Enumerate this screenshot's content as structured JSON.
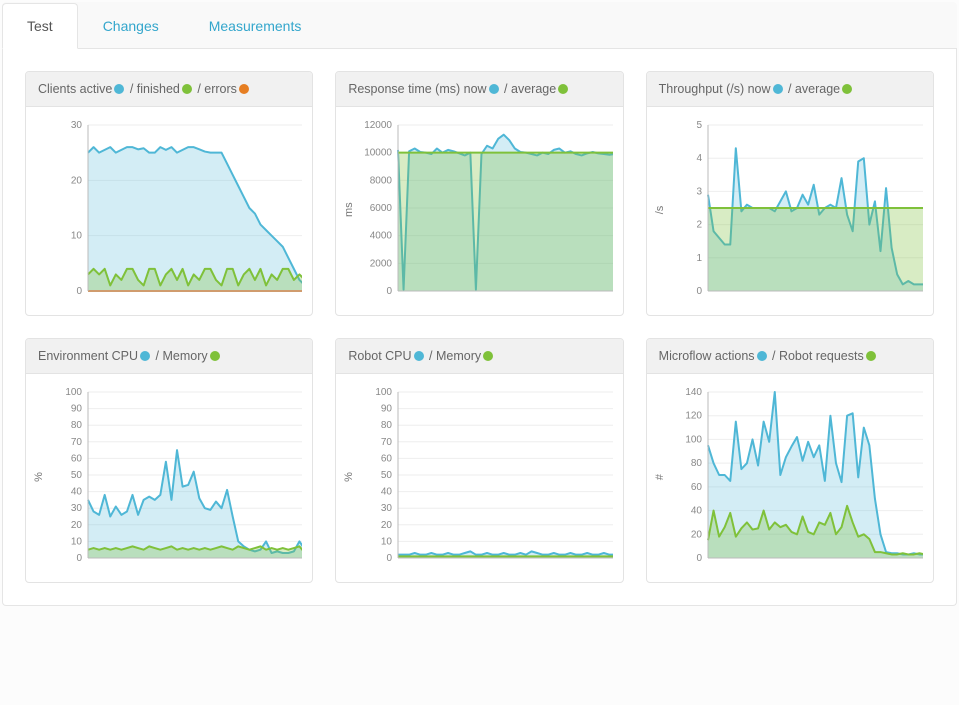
{
  "tabs": {
    "test": "Test",
    "changes": "Changes",
    "measurements": "Measurements"
  },
  "colors": {
    "blue": "#4fb7d6",
    "green": "#7fc13a",
    "orange": "#e67e22"
  },
  "cards": [
    {
      "title_parts": [
        "Clients active",
        " / finished",
        " / errors"
      ],
      "ylabel": ""
    },
    {
      "title_parts": [
        "Response time (ms) now",
        " / average"
      ],
      "ylabel": "ms"
    },
    {
      "title_parts": [
        "Throughput (/s) now",
        " / average"
      ],
      "ylabel": "/s"
    },
    {
      "title_parts": [
        "Environment CPU",
        " / Memory"
      ],
      "ylabel": "%"
    },
    {
      "title_parts": [
        "Robot CPU",
        " / Memory"
      ],
      "ylabel": "%"
    },
    {
      "title_parts": [
        "Microflow actions",
        " / Robot requests"
      ],
      "ylabel": "#"
    }
  ],
  "chart_data": [
    {
      "type": "area",
      "title": "Clients active / finished / errors",
      "ylabel": "",
      "ylim": [
        0,
        30
      ],
      "yticks": [
        0,
        10,
        20,
        30
      ],
      "x": [
        0,
        1,
        2,
        3,
        4,
        5,
        6,
        7,
        8,
        9,
        10,
        11,
        12,
        13,
        14,
        15,
        16,
        17,
        18,
        19,
        20,
        21,
        22,
        23,
        24,
        25,
        26,
        27,
        28,
        29,
        30,
        31,
        32,
        33,
        34,
        35,
        36,
        37,
        38,
        39
      ],
      "series": [
        {
          "name": "active",
          "color": "blue",
          "values": [
            25,
            26,
            25,
            25.5,
            26,
            25,
            25.5,
            26,
            26,
            25.6,
            25.8,
            25,
            25,
            26,
            25.5,
            26,
            25,
            25.5,
            26,
            26,
            25.6,
            25.2,
            25,
            25,
            25,
            23,
            21,
            19,
            17,
            15,
            14,
            12,
            11,
            10,
            9,
            8,
            6,
            4,
            2,
            1
          ]
        },
        {
          "name": "finished",
          "color": "green",
          "values": [
            3,
            4,
            3,
            4,
            1,
            3,
            2,
            4,
            4,
            2,
            1,
            4,
            4,
            1,
            3,
            4,
            2,
            4,
            1,
            3,
            2,
            4,
            4,
            2,
            1,
            4,
            4,
            1,
            3,
            4,
            2,
            4,
            1,
            3,
            2,
            4,
            4,
            2,
            3,
            2
          ]
        },
        {
          "name": "errors",
          "color": "orange",
          "line_only": true,
          "values": [
            0,
            0,
            0,
            0,
            0,
            0,
            0,
            0,
            0,
            0,
            0,
            0,
            0,
            0,
            0,
            0,
            0,
            0,
            0,
            0,
            0,
            0,
            0,
            0,
            0,
            0,
            0,
            0,
            0,
            0,
            0,
            0,
            0,
            0,
            0,
            0,
            0,
            0,
            0,
            0
          ]
        }
      ]
    },
    {
      "type": "area",
      "title": "Response time (ms) now / average",
      "ylabel": "ms",
      "ylim": [
        0,
        12000
      ],
      "yticks": [
        0,
        2000,
        4000,
        6000,
        8000,
        10000,
        12000
      ],
      "x": [
        0,
        1,
        2,
        3,
        4,
        5,
        6,
        7,
        8,
        9,
        10,
        11,
        12,
        13,
        14,
        15,
        16,
        17,
        18,
        19,
        20,
        21,
        22,
        23,
        24,
        25,
        26,
        27,
        28,
        29,
        30,
        31,
        32,
        33,
        34,
        35,
        36,
        37,
        38,
        39
      ],
      "series": [
        {
          "name": "now",
          "color": "blue",
          "values": [
            10200,
            100,
            10100,
            10300,
            10050,
            10000,
            9900,
            10300,
            10000,
            10200,
            10100,
            9950,
            9800,
            10000,
            100,
            9900,
            10500,
            10300,
            11000,
            11300,
            10900,
            10300,
            10050,
            10000,
            9900,
            9800,
            10000,
            9900,
            10200,
            10300,
            10000,
            10100,
            9900,
            9800,
            9950,
            10050,
            9950,
            9900,
            9850,
            9900
          ]
        },
        {
          "name": "average",
          "color": "green",
          "values": [
            10000,
            10000,
            10000,
            10000,
            10000,
            10000,
            10000,
            10000,
            10000,
            10000,
            10000,
            10000,
            10000,
            10000,
            10000,
            10000,
            10000,
            10000,
            10000,
            10000,
            10000,
            10000,
            10000,
            10000,
            10000,
            10000,
            10000,
            10000,
            10000,
            10000,
            10000,
            10000,
            10000,
            10000,
            10000,
            10000,
            10000,
            10000,
            10000,
            10000
          ]
        }
      ]
    },
    {
      "type": "area",
      "title": "Throughput (/s) now / average",
      "ylabel": "/s",
      "ylim": [
        0,
        5
      ],
      "yticks": [
        0,
        1,
        2,
        3,
        4,
        5
      ],
      "x": [
        0,
        1,
        2,
        3,
        4,
        5,
        6,
        7,
        8,
        9,
        10,
        11,
        12,
        13,
        14,
        15,
        16,
        17,
        18,
        19,
        20,
        21,
        22,
        23,
        24,
        25,
        26,
        27,
        28,
        29,
        30,
        31,
        32,
        33,
        34,
        35,
        36,
        37,
        38,
        39
      ],
      "series": [
        {
          "name": "now",
          "color": "blue",
          "values": [
            2.9,
            1.8,
            1.6,
            1.4,
            1.4,
            4.3,
            2.4,
            2.6,
            2.5,
            2.5,
            2.5,
            2.5,
            2.4,
            2.7,
            3.0,
            2.4,
            2.5,
            2.9,
            2.6,
            3.2,
            2.3,
            2.5,
            2.6,
            2.5,
            3.4,
            2.3,
            1.8,
            3.9,
            4.0,
            2.0,
            2.7,
            1.2,
            3.1,
            1.3,
            0.5,
            0.2,
            0.3,
            0.2,
            0.2,
            0.2
          ]
        },
        {
          "name": "average",
          "color": "green",
          "values": [
            2.5,
            2.5,
            2.5,
            2.5,
            2.5,
            2.5,
            2.5,
            2.5,
            2.5,
            2.5,
            2.5,
            2.5,
            2.5,
            2.5,
            2.5,
            2.5,
            2.5,
            2.5,
            2.5,
            2.5,
            2.5,
            2.5,
            2.5,
            2.5,
            2.5,
            2.5,
            2.5,
            2.5,
            2.5,
            2.5,
            2.5,
            2.5,
            2.5,
            2.5,
            2.5,
            2.5,
            2.5,
            2.5,
            2.5,
            2.5
          ]
        }
      ]
    },
    {
      "type": "area",
      "title": "Environment CPU / Memory",
      "ylabel": "%",
      "ylim": [
        0,
        100
      ],
      "yticks": [
        0,
        10,
        20,
        30,
        40,
        50,
        60,
        70,
        80,
        90,
        100
      ],
      "x": [
        0,
        1,
        2,
        3,
        4,
        5,
        6,
        7,
        8,
        9,
        10,
        11,
        12,
        13,
        14,
        15,
        16,
        17,
        18,
        19,
        20,
        21,
        22,
        23,
        24,
        25,
        26,
        27,
        28,
        29,
        30,
        31,
        32,
        33,
        34,
        35,
        36,
        37,
        38,
        39
      ],
      "series": [
        {
          "name": "CPU",
          "color": "blue",
          "values": [
            35,
            28,
            26,
            38,
            25,
            31,
            26,
            28,
            38,
            26,
            35,
            37,
            35,
            38,
            58,
            35,
            65,
            43,
            44,
            52,
            36,
            30,
            29,
            34,
            30,
            41,
            25,
            10,
            7,
            5,
            4,
            5,
            10,
            3,
            4,
            3,
            3,
            4,
            10,
            5
          ]
        },
        {
          "name": "Memory",
          "color": "green",
          "values": [
            5,
            6,
            5,
            6,
            5,
            6,
            5,
            6,
            7,
            6,
            5,
            7,
            6,
            5,
            6,
            7,
            5,
            6,
            5,
            6,
            5,
            6,
            5,
            6,
            7,
            6,
            5,
            7,
            6,
            5,
            6,
            7,
            5,
            6,
            5,
            6,
            5,
            6,
            7,
            3
          ]
        }
      ]
    },
    {
      "type": "area",
      "title": "Robot CPU / Memory",
      "ylabel": "%",
      "ylim": [
        0,
        100
      ],
      "yticks": [
        0,
        10,
        20,
        30,
        40,
        50,
        60,
        70,
        80,
        90,
        100
      ],
      "x": [
        0,
        1,
        2,
        3,
        4,
        5,
        6,
        7,
        8,
        9,
        10,
        11,
        12,
        13,
        14,
        15,
        16,
        17,
        18,
        19,
        20,
        21,
        22,
        23,
        24,
        25,
        26,
        27,
        28,
        29,
        30,
        31,
        32,
        33,
        34,
        35,
        36,
        37,
        38,
        39
      ],
      "series": [
        {
          "name": "CPU",
          "color": "blue",
          "values": [
            2,
            2,
            2,
            3,
            2,
            2,
            3,
            2,
            2,
            3,
            2,
            2,
            3,
            4,
            2,
            2,
            3,
            2,
            2,
            3,
            2,
            2,
            3,
            2,
            4,
            3,
            2,
            2,
            3,
            2,
            2,
            3,
            2,
            2,
            3,
            2,
            2,
            3,
            2,
            2
          ]
        },
        {
          "name": "Memory",
          "color": "green",
          "values": [
            1,
            1,
            1,
            1,
            1,
            1,
            1,
            1,
            1,
            1,
            1,
            1,
            1,
            1,
            1,
            1,
            1,
            1,
            1,
            1,
            1,
            1,
            1,
            1,
            1,
            1,
            1,
            1,
            1,
            1,
            1,
            1,
            1,
            1,
            1,
            1,
            1,
            1,
            1,
            1
          ]
        }
      ]
    },
    {
      "type": "area",
      "title": "Microflow actions / Robot requests",
      "ylabel": "#",
      "ylim": [
        0,
        140
      ],
      "yticks": [
        0,
        20,
        40,
        60,
        80,
        100,
        120,
        140
      ],
      "x": [
        0,
        1,
        2,
        3,
        4,
        5,
        6,
        7,
        8,
        9,
        10,
        11,
        12,
        13,
        14,
        15,
        16,
        17,
        18,
        19,
        20,
        21,
        22,
        23,
        24,
        25,
        26,
        27,
        28,
        29,
        30,
        31,
        32,
        33,
        34,
        35,
        36,
        37,
        38,
        39
      ],
      "series": [
        {
          "name": "microflow",
          "color": "blue",
          "values": [
            95,
            80,
            70,
            70,
            65,
            115,
            75,
            80,
            100,
            78,
            115,
            98,
            140,
            70,
            85,
            94,
            102,
            82,
            98,
            85,
            95,
            65,
            120,
            80,
            64,
            120,
            122,
            68,
            110,
            95,
            50,
            20,
            5,
            4,
            4,
            3,
            3,
            4,
            3,
            3
          ]
        },
        {
          "name": "robot",
          "color": "green",
          "values": [
            15,
            40,
            18,
            26,
            38,
            18,
            25,
            30,
            24,
            25,
            40,
            24,
            30,
            26,
            28,
            22,
            20,
            35,
            22,
            20,
            30,
            28,
            38,
            20,
            26,
            44,
            30,
            18,
            20,
            16,
            5,
            5,
            4,
            3,
            3,
            4,
            3,
            3,
            4,
            3
          ]
        }
      ]
    }
  ]
}
